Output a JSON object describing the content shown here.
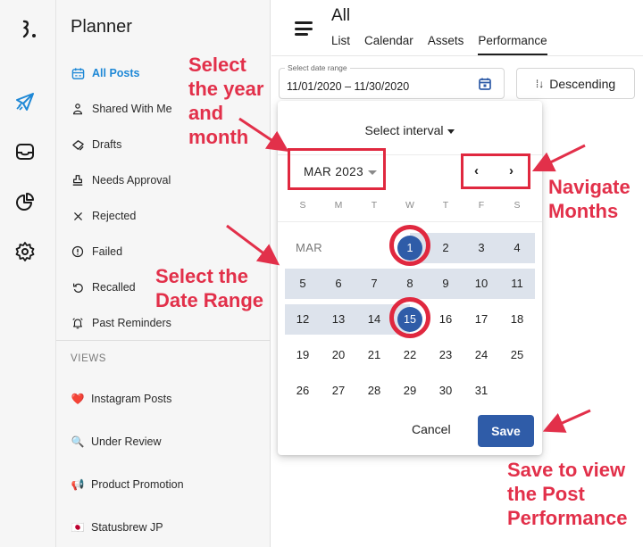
{
  "rail": {
    "icons": [
      "logo-icon",
      "send-icon",
      "inbox-icon",
      "pie-chart-icon",
      "settings-icon"
    ],
    "active_color": "#1e88d6"
  },
  "sidebar": {
    "title": "Planner",
    "items": [
      {
        "label": "All Posts",
        "icon": "calendar-icon",
        "active": true
      },
      {
        "label": "Shared With Me",
        "icon": "person-icon"
      },
      {
        "label": "Drafts",
        "icon": "drafts-icon"
      },
      {
        "label": "Needs Approval",
        "icon": "stamp-icon"
      },
      {
        "label": "Rejected",
        "icon": "close-icon"
      },
      {
        "label": "Failed",
        "icon": "alert-circle-icon"
      },
      {
        "label": "Recalled",
        "icon": "undo-icon"
      },
      {
        "label": "Past Reminders",
        "icon": "alarm-icon"
      }
    ],
    "views_heading": "VIEWS",
    "views": [
      {
        "label": "Instagram Posts",
        "emoji": "❤️"
      },
      {
        "label": "Under Review",
        "emoji": "🔍"
      },
      {
        "label": "Product Promotion",
        "emoji": "📢"
      },
      {
        "label": "Statusbrew JP",
        "emoji": "🇯🇵"
      }
    ]
  },
  "header": {
    "title": "All",
    "tabs": [
      {
        "label": "List"
      },
      {
        "label": "Calendar"
      },
      {
        "label": "Assets"
      },
      {
        "label": "Performance",
        "active": true
      }
    ]
  },
  "toolbar": {
    "date_range_label": "Select date range",
    "date_range_value": "11/01/2020 – 11/30/2020",
    "sort_label": "Descending"
  },
  "datepicker": {
    "interval_label": "Select interval",
    "month_year": "MAR 2023",
    "prev_label": "‹",
    "next_label": "›",
    "weekdays": [
      "S",
      "M",
      "T",
      "W",
      "T",
      "F",
      "S"
    ],
    "month_short": "MAR",
    "first_weekday_index": 3,
    "days_in_month": 31,
    "range_start": 1,
    "range_end": 15,
    "cancel_label": "Cancel",
    "save_label": "Save",
    "accent_color": "#2f5ca8",
    "range_color": "#dde3ec"
  },
  "annotations": {
    "color": "#e2304a",
    "select_year_month": [
      "Select",
      "the year",
      "and",
      "month"
    ],
    "select_date_range": [
      "Select the",
      "Date Range"
    ],
    "navigate_months": [
      "Navigate",
      "Months"
    ],
    "save_to_view": [
      "Save to view",
      "the Post",
      "Performance"
    ]
  }
}
